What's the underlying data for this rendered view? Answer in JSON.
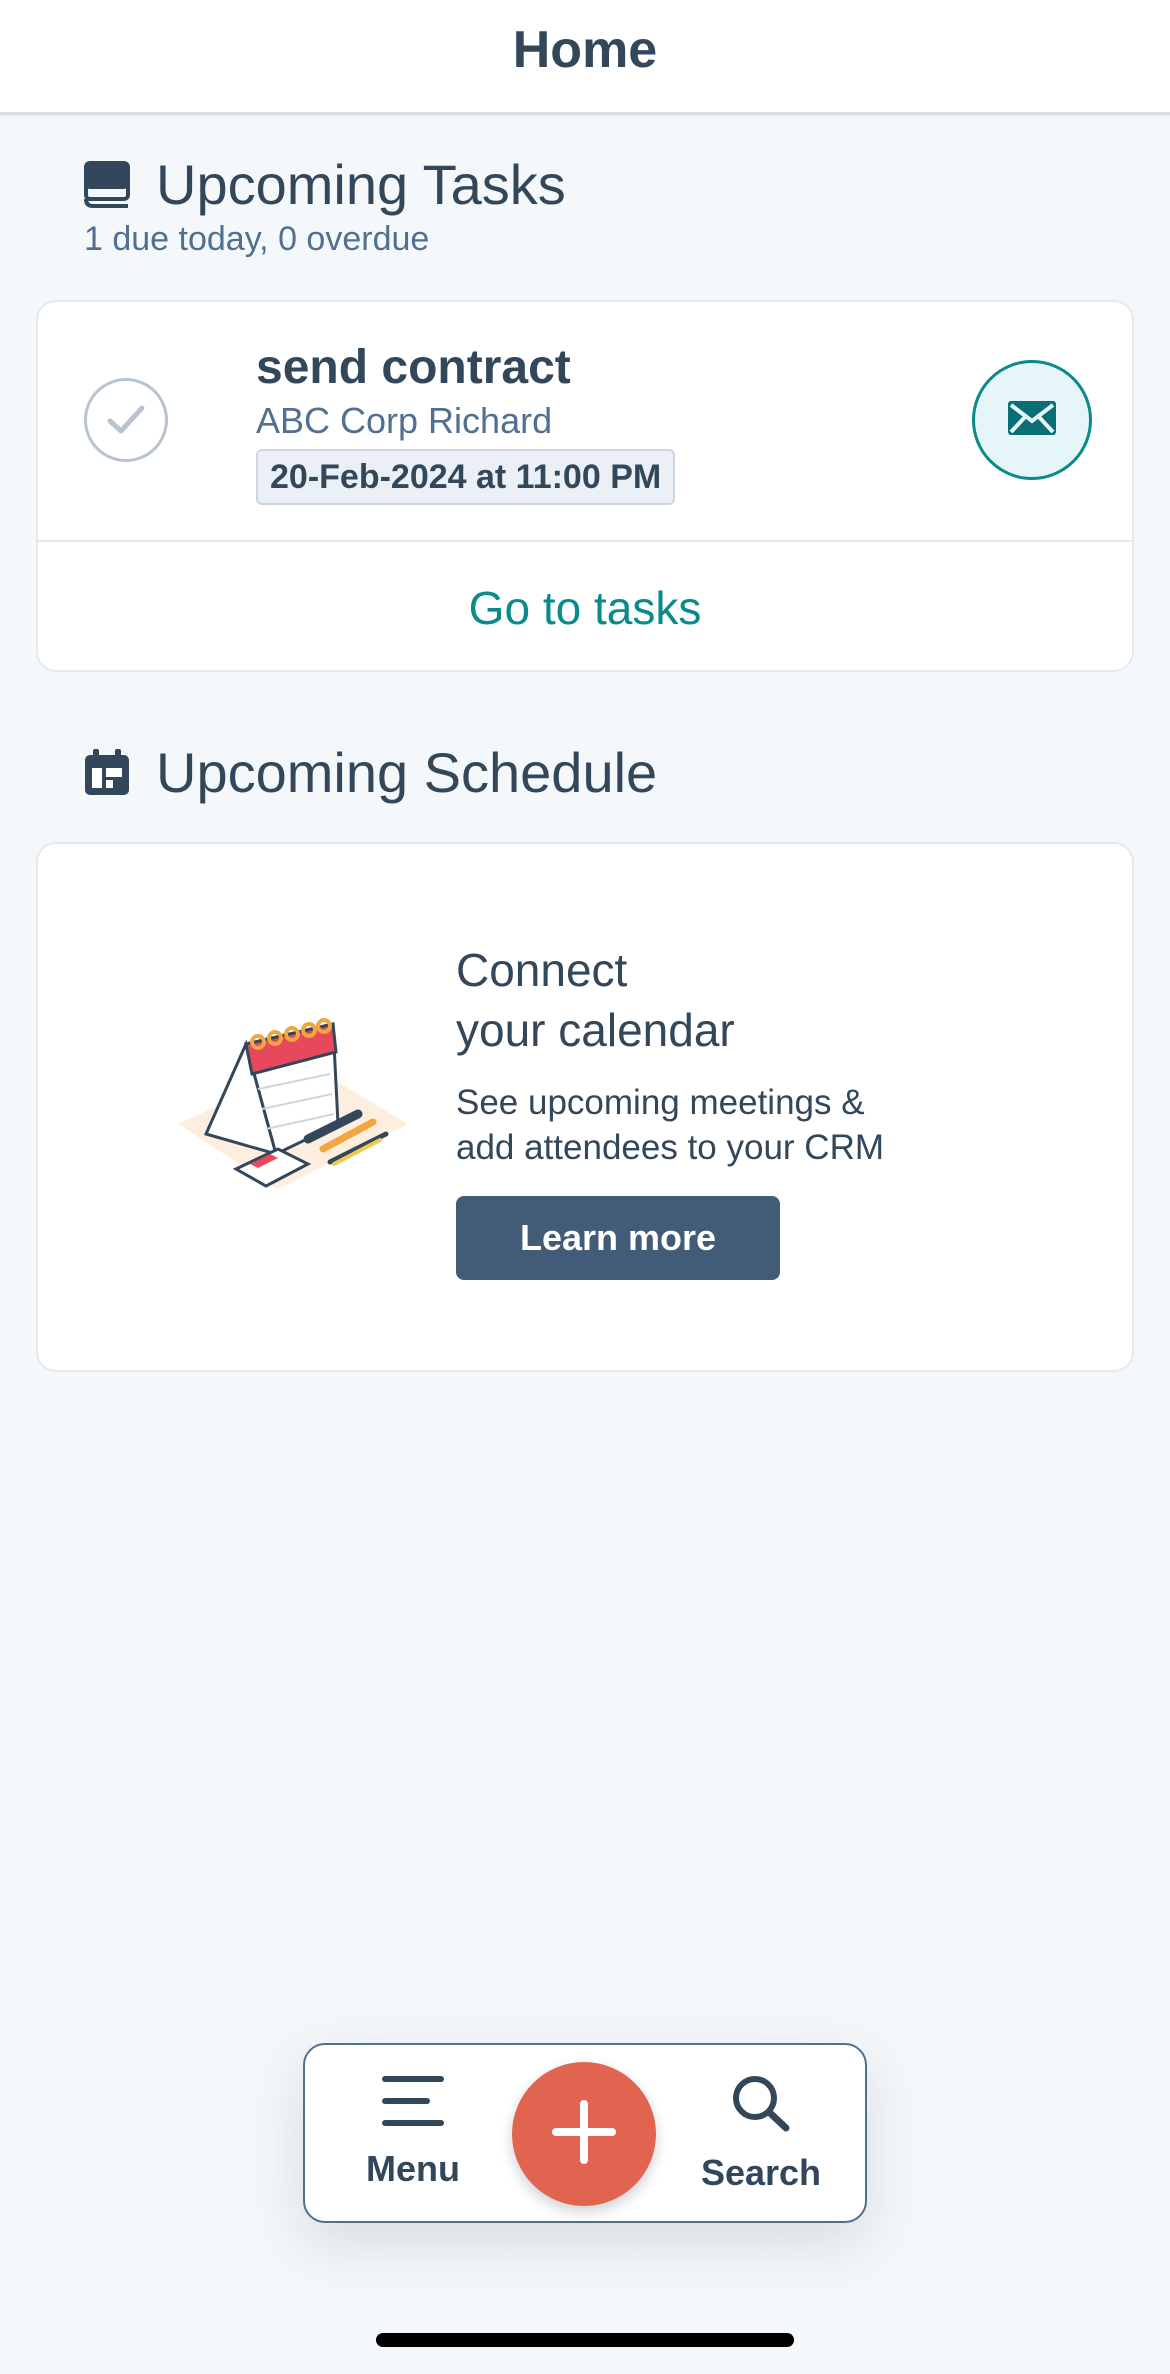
{
  "header": {
    "title": "Home"
  },
  "tasks": {
    "title": "Upcoming Tasks",
    "summary": "1 due today, 0 overdue",
    "items": [
      {
        "name": "send contract",
        "company": "ABC Corp Richard",
        "due": "20-Feb-2024 at 11:00 PM"
      }
    ],
    "go_to_label": "Go to tasks"
  },
  "schedule": {
    "title": "Upcoming Schedule",
    "connect_title_line1": "Connect",
    "connect_title_line2": "your calendar",
    "connect_desc_line1": "See upcoming meetings &",
    "connect_desc_line2": "add attendees to your CRM",
    "learn_more_label": "Learn more"
  },
  "nav": {
    "menu_label": "Menu",
    "search_label": "Search"
  },
  "colors": {
    "accent_teal": "#0b8a8a",
    "fab_orange": "#e0644f",
    "button_slate": "#425b76",
    "text_dark": "#33475b"
  },
  "icons": {
    "tasks_section": "task-book-icon",
    "schedule_section": "calendar-icon",
    "task_check": "check-circle-icon",
    "task_action": "email-icon",
    "menu": "hamburger-icon",
    "search": "search-icon",
    "add": "plus-icon"
  }
}
